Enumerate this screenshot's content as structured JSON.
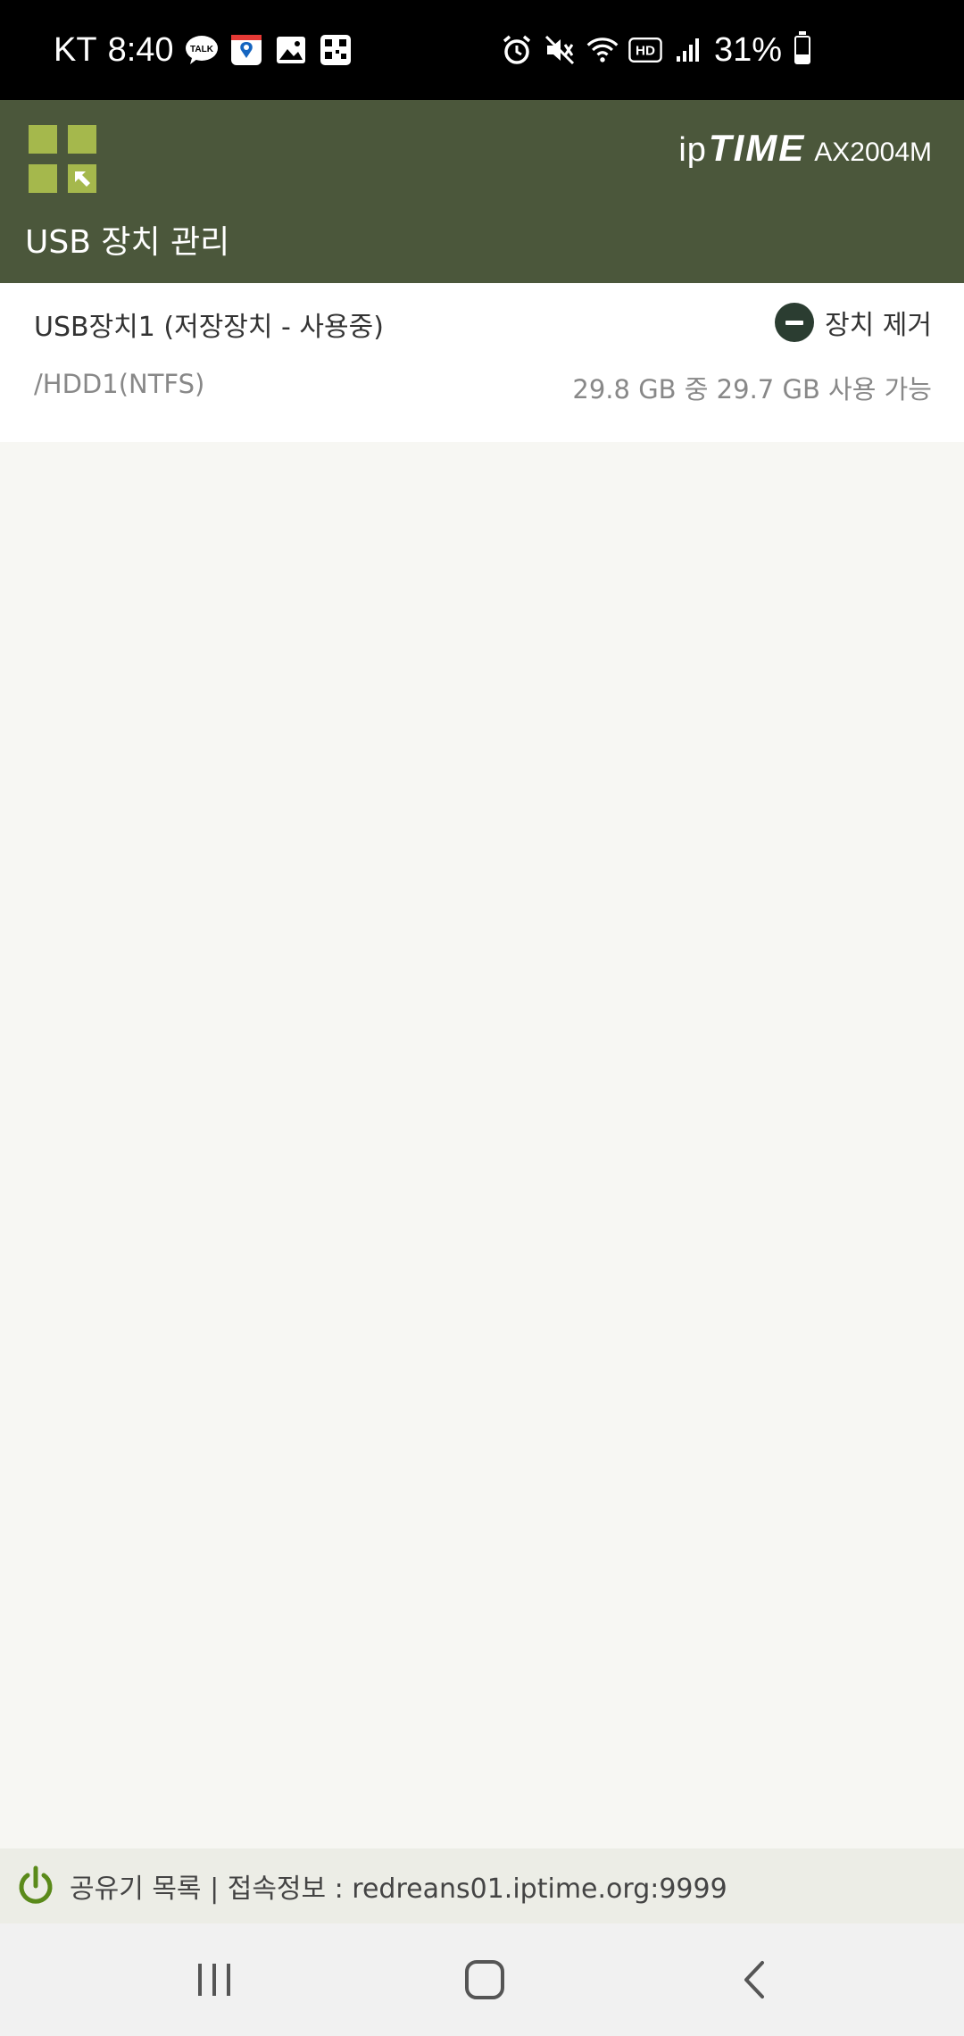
{
  "status_bar": {
    "carrier": "KT",
    "time": "8:40",
    "battery": "31%",
    "battery_level": 0.31,
    "icons": [
      "talk-icon",
      "map-icon",
      "gallery-icon",
      "qr-icon",
      "alarm-icon",
      "mute-icon",
      "wifi-icon",
      "hd-icon",
      "signal-icon",
      "battery-icon"
    ]
  },
  "header": {
    "brand_prefix": "ip",
    "brand_name": "TIME",
    "model": "AX2004M",
    "title": "USB 장치 관리",
    "accent_color": "#a5b84c",
    "background_color": "#4b573b"
  },
  "device": {
    "name": "USB장치1  (저장장치 - 사용중)",
    "path": "/HDD1(NTFS)",
    "capacity": "29.8 GB 중 29.7 GB 사용 가능",
    "remove_label": "장치 제거"
  },
  "footer": {
    "text": "공유기 목록  |  접속정보 : redreans01.iptime.org:9999",
    "power_color": "#5a8a1a"
  },
  "nav": {
    "buttons": [
      "recent-apps",
      "home",
      "back"
    ]
  }
}
